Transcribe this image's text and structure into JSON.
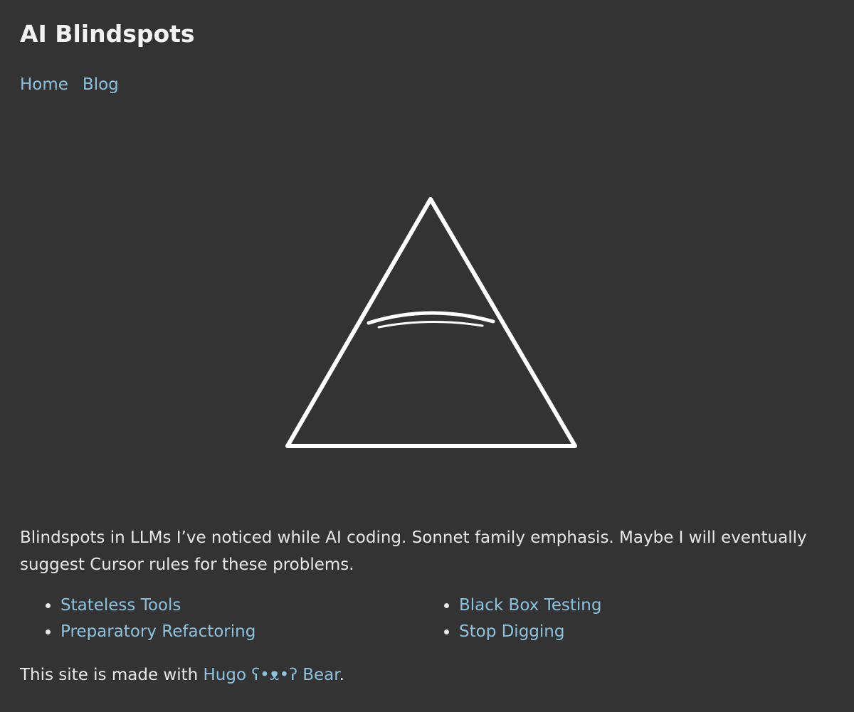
{
  "header": {
    "title": "AI Blindspots"
  },
  "nav": {
    "items": [
      {
        "label": "Home"
      },
      {
        "label": "Blog"
      }
    ]
  },
  "logo": {
    "icon": "triangle-eye-icon",
    "color": "#ffffff"
  },
  "intro": {
    "text": "Blindspots in LLMs I’ve noticed while AI coding. Sonnet family emphasis. Maybe I will eventually suggest Cursor rules for these problems."
  },
  "posts": [
    {
      "label": "Stateless Tools"
    },
    {
      "label": "Black Box Testing"
    },
    {
      "label": "Preparatory Refactoring"
    },
    {
      "label": "Stop Digging"
    }
  ],
  "footer": {
    "prefix": "This site is made with ",
    "link_label": "Hugo ʕ•ᴥ•ʔ Bear",
    "suffix": "."
  },
  "colors": {
    "background": "#333333",
    "text": "#e8e8e8",
    "link": "#8cc2dd"
  }
}
